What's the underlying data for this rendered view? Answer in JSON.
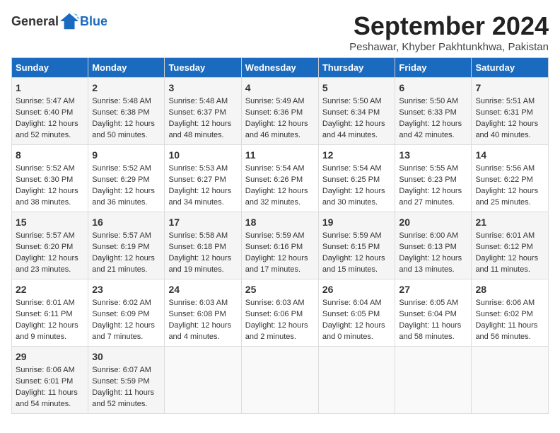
{
  "header": {
    "logo_general": "General",
    "logo_blue": "Blue",
    "month_title": "September 2024",
    "location": "Peshawar, Khyber Pakhtunkhwa, Pakistan"
  },
  "columns": [
    "Sunday",
    "Monday",
    "Tuesday",
    "Wednesday",
    "Thursday",
    "Friday",
    "Saturday"
  ],
  "weeks": [
    [
      {
        "day": "1",
        "lines": [
          "Sunrise: 5:47 AM",
          "Sunset: 6:40 PM",
          "Daylight: 12 hours",
          "and 52 minutes."
        ]
      },
      {
        "day": "2",
        "lines": [
          "Sunrise: 5:48 AM",
          "Sunset: 6:38 PM",
          "Daylight: 12 hours",
          "and 50 minutes."
        ]
      },
      {
        "day": "3",
        "lines": [
          "Sunrise: 5:48 AM",
          "Sunset: 6:37 PM",
          "Daylight: 12 hours",
          "and 48 minutes."
        ]
      },
      {
        "day": "4",
        "lines": [
          "Sunrise: 5:49 AM",
          "Sunset: 6:36 PM",
          "Daylight: 12 hours",
          "and 46 minutes."
        ]
      },
      {
        "day": "5",
        "lines": [
          "Sunrise: 5:50 AM",
          "Sunset: 6:34 PM",
          "Daylight: 12 hours",
          "and 44 minutes."
        ]
      },
      {
        "day": "6",
        "lines": [
          "Sunrise: 5:50 AM",
          "Sunset: 6:33 PM",
          "Daylight: 12 hours",
          "and 42 minutes."
        ]
      },
      {
        "day": "7",
        "lines": [
          "Sunrise: 5:51 AM",
          "Sunset: 6:31 PM",
          "Daylight: 12 hours",
          "and 40 minutes."
        ]
      }
    ],
    [
      {
        "day": "8",
        "lines": [
          "Sunrise: 5:52 AM",
          "Sunset: 6:30 PM",
          "Daylight: 12 hours",
          "and 38 minutes."
        ]
      },
      {
        "day": "9",
        "lines": [
          "Sunrise: 5:52 AM",
          "Sunset: 6:29 PM",
          "Daylight: 12 hours",
          "and 36 minutes."
        ]
      },
      {
        "day": "10",
        "lines": [
          "Sunrise: 5:53 AM",
          "Sunset: 6:27 PM",
          "Daylight: 12 hours",
          "and 34 minutes."
        ]
      },
      {
        "day": "11",
        "lines": [
          "Sunrise: 5:54 AM",
          "Sunset: 6:26 PM",
          "Daylight: 12 hours",
          "and 32 minutes."
        ]
      },
      {
        "day": "12",
        "lines": [
          "Sunrise: 5:54 AM",
          "Sunset: 6:25 PM",
          "Daylight: 12 hours",
          "and 30 minutes."
        ]
      },
      {
        "day": "13",
        "lines": [
          "Sunrise: 5:55 AM",
          "Sunset: 6:23 PM",
          "Daylight: 12 hours",
          "and 27 minutes."
        ]
      },
      {
        "day": "14",
        "lines": [
          "Sunrise: 5:56 AM",
          "Sunset: 6:22 PM",
          "Daylight: 12 hours",
          "and 25 minutes."
        ]
      }
    ],
    [
      {
        "day": "15",
        "lines": [
          "Sunrise: 5:57 AM",
          "Sunset: 6:20 PM",
          "Daylight: 12 hours",
          "and 23 minutes."
        ]
      },
      {
        "day": "16",
        "lines": [
          "Sunrise: 5:57 AM",
          "Sunset: 6:19 PM",
          "Daylight: 12 hours",
          "and 21 minutes."
        ]
      },
      {
        "day": "17",
        "lines": [
          "Sunrise: 5:58 AM",
          "Sunset: 6:18 PM",
          "Daylight: 12 hours",
          "and 19 minutes."
        ]
      },
      {
        "day": "18",
        "lines": [
          "Sunrise: 5:59 AM",
          "Sunset: 6:16 PM",
          "Daylight: 12 hours",
          "and 17 minutes."
        ]
      },
      {
        "day": "19",
        "lines": [
          "Sunrise: 5:59 AM",
          "Sunset: 6:15 PM",
          "Daylight: 12 hours",
          "and 15 minutes."
        ]
      },
      {
        "day": "20",
        "lines": [
          "Sunrise: 6:00 AM",
          "Sunset: 6:13 PM",
          "Daylight: 12 hours",
          "and 13 minutes."
        ]
      },
      {
        "day": "21",
        "lines": [
          "Sunrise: 6:01 AM",
          "Sunset: 6:12 PM",
          "Daylight: 12 hours",
          "and 11 minutes."
        ]
      }
    ],
    [
      {
        "day": "22",
        "lines": [
          "Sunrise: 6:01 AM",
          "Sunset: 6:11 PM",
          "Daylight: 12 hours",
          "and 9 minutes."
        ]
      },
      {
        "day": "23",
        "lines": [
          "Sunrise: 6:02 AM",
          "Sunset: 6:09 PM",
          "Daylight: 12 hours",
          "and 7 minutes."
        ]
      },
      {
        "day": "24",
        "lines": [
          "Sunrise: 6:03 AM",
          "Sunset: 6:08 PM",
          "Daylight: 12 hours",
          "and 4 minutes."
        ]
      },
      {
        "day": "25",
        "lines": [
          "Sunrise: 6:03 AM",
          "Sunset: 6:06 PM",
          "Daylight: 12 hours",
          "and 2 minutes."
        ]
      },
      {
        "day": "26",
        "lines": [
          "Sunrise: 6:04 AM",
          "Sunset: 6:05 PM",
          "Daylight: 12 hours",
          "and 0 minutes."
        ]
      },
      {
        "day": "27",
        "lines": [
          "Sunrise: 6:05 AM",
          "Sunset: 6:04 PM",
          "Daylight: 11 hours",
          "and 58 minutes."
        ]
      },
      {
        "day": "28",
        "lines": [
          "Sunrise: 6:06 AM",
          "Sunset: 6:02 PM",
          "Daylight: 11 hours",
          "and 56 minutes."
        ]
      }
    ],
    [
      {
        "day": "29",
        "lines": [
          "Sunrise: 6:06 AM",
          "Sunset: 6:01 PM",
          "Daylight: 11 hours",
          "and 54 minutes."
        ]
      },
      {
        "day": "30",
        "lines": [
          "Sunrise: 6:07 AM",
          "Sunset: 5:59 PM",
          "Daylight: 11 hours",
          "and 52 minutes."
        ]
      },
      {
        "day": "",
        "lines": []
      },
      {
        "day": "",
        "lines": []
      },
      {
        "day": "",
        "lines": []
      },
      {
        "day": "",
        "lines": []
      },
      {
        "day": "",
        "lines": []
      }
    ]
  ]
}
